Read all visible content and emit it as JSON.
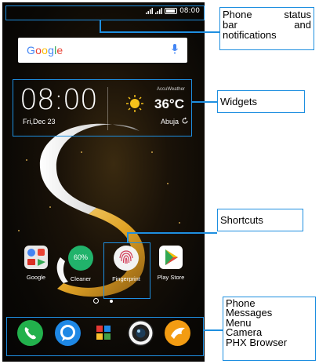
{
  "status_bar": {
    "time": "08:00",
    "battery": "100%"
  },
  "search": {
    "logo": "Google",
    "mic_icon": "microphone-icon"
  },
  "widgets": {
    "clock": "08:00",
    "date": "Fri,Dec 23",
    "weather_provider": "AccuWeather",
    "temperature": "36°C",
    "city": "Abuja"
  },
  "apps": [
    {
      "label": "Google",
      "icon": "google-folder-icon"
    },
    {
      "label": "Cleaner",
      "icon": "cleaner-icon",
      "badge": "60%"
    },
    {
      "label": "Fingerprint",
      "icon": "fingerprint-icon"
    },
    {
      "label": "Play Store",
      "icon": "play-store-icon"
    }
  ],
  "dock": [
    {
      "name": "Phone",
      "icon": "phone-icon"
    },
    {
      "name": "Messages",
      "icon": "messages-icon"
    },
    {
      "name": "Menu",
      "icon": "menu-icon"
    },
    {
      "name": "Camera",
      "icon": "camera-icon"
    },
    {
      "name": "PHX Browser",
      "icon": "browser-icon"
    }
  ],
  "callouts": {
    "status_line1_a": "Phone",
    "status_line1_b": "status",
    "status_line2_a": "bar",
    "status_line2_b": "and",
    "status_line3": "notifications",
    "widgets": "Widgets",
    "shortcuts": "Shortcuts",
    "dock_lines": [
      "Phone",
      "Messages",
      "Menu",
      "Camera",
      "PHX Browser"
    ]
  },
  "colors": {
    "accent": "#1e8fe0",
    "gold": "#f4b731"
  }
}
